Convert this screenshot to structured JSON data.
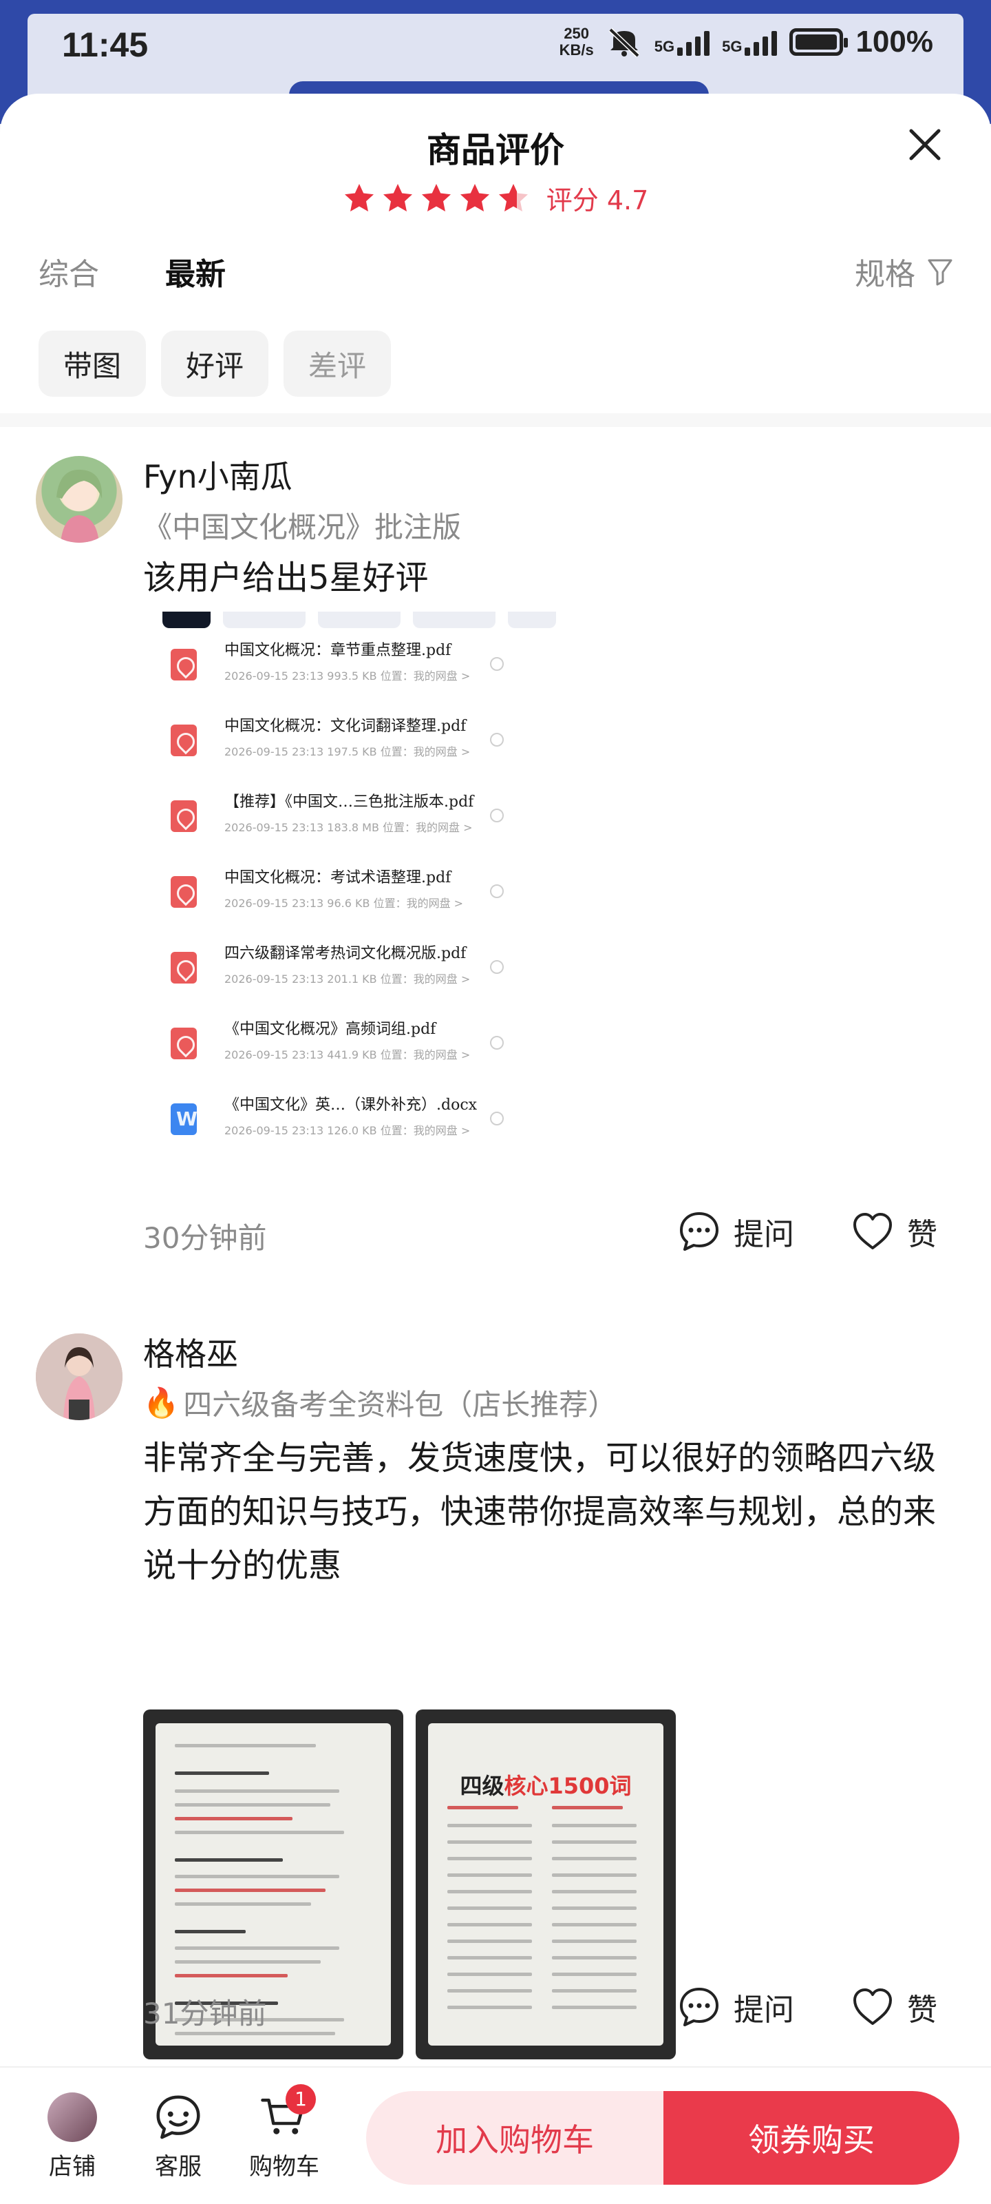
{
  "status_bar": {
    "time": "11:45",
    "net_speed_value": "250",
    "net_speed_unit": "KB/s",
    "sim1": "5G",
    "sim2": "5G",
    "battery": "100%"
  },
  "sheet": {
    "title": "商品评价",
    "rating_value": 4.7,
    "rating_label": "评分 4.7",
    "accent_color": "#e23a4b"
  },
  "tabs": [
    {
      "label": "综合",
      "active": false
    },
    {
      "label": "最新",
      "active": true
    }
  ],
  "spec_filter_label": "规格",
  "chips": [
    {
      "label": "带图"
    },
    {
      "label": "好评"
    },
    {
      "label": "差评"
    }
  ],
  "reviews": [
    {
      "name": "Fyn小南瓜",
      "variant": "《中国文化概况》批注版",
      "text": "该用户给出5星好评",
      "time": "30分钟前",
      "ask_label": "提问",
      "like_label": "赞",
      "files": [
        {
          "name": "中国文化概况：章节重点整理.pdf",
          "date": "2026-09-15 23:13",
          "size": "993.5 KB",
          "location": "位置：我的网盘 >",
          "type": "pdf"
        },
        {
          "name": "中国文化概况：文化词翻译整理.pdf",
          "date": "2026-09-15 23:13",
          "size": "197.5 KB",
          "location": "位置：我的网盘 >",
          "type": "pdf"
        },
        {
          "name": "【推荐】《中国文…三色批注版本.pdf",
          "date": "2026-09-15 23:13",
          "size": "183.8 MB",
          "location": "位置：我的网盘 >",
          "type": "pdf"
        },
        {
          "name": "中国文化概况：考试术语整理.pdf",
          "date": "2026-09-15 23:13",
          "size": "96.6 KB",
          "location": "位置：我的网盘 >",
          "type": "pdf"
        },
        {
          "name": "四六级翻译常考热词文化概况版.pdf",
          "date": "2026-09-15 23:13",
          "size": "201.1 KB",
          "location": "位置：我的网盘 >",
          "type": "pdf"
        },
        {
          "name": "《中国文化概况》高频词组.pdf",
          "date": "2026-09-15 23:13",
          "size": "441.9 KB",
          "location": "位置：我的网盘 >",
          "type": "pdf"
        },
        {
          "name": "《中国文化》英…（课外补充）.docx",
          "date": "2026-09-15 23:13",
          "size": "126.0 KB",
          "location": "位置：我的网盘 >",
          "type": "docx"
        }
      ]
    },
    {
      "name": "格格巫",
      "variant_icon": "🔥",
      "variant": "四六级备考全资料包（店长推荐）",
      "text": "非常齐全与完善，发货速度快，可以很好的领略四六级方面的知识与技巧，快速带你提高效率与规划，总的来说十分的优惠",
      "time": "31分钟前",
      "ask_label": "提问",
      "like_label": "赞",
      "photo2_title_prefix": "四级",
      "photo2_title_highlight": "核心1500词"
    }
  ],
  "bottom_bar": {
    "shop_label": "店铺",
    "service_label": "客服",
    "cart_label": "购物车",
    "cart_badge": "1",
    "add_to_cart": "加入购物车",
    "buy_now": "领券购买"
  }
}
